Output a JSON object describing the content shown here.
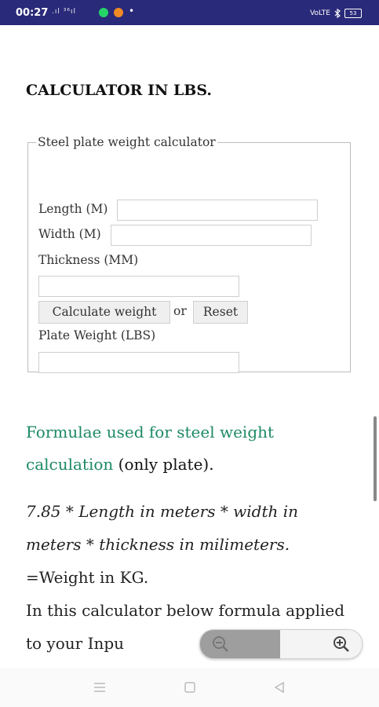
{
  "status_bar": {
    "time": "00:27",
    "signal_text": ".ıl ³⁶ıl",
    "more": "•",
    "network": "VoLTE",
    "battery": "53"
  },
  "page": {
    "heading": "CALCULATOR IN LBS.",
    "form": {
      "legend": "Steel plate weight calculator",
      "length_label": "Length (M)",
      "length_value": "",
      "width_label": "Width (M)",
      "width_value": "",
      "thickness_label": "Thickness (MM)",
      "thickness_value": "",
      "calculate_label": "Calculate weight",
      "or_text": "or",
      "reset_label": "Reset",
      "result_label": "Plate Weight (LBS)",
      "result_value": ""
    },
    "formula": {
      "title_link": "Formulae used for steel weight calculation",
      "title_suffix": " (only plate).",
      "expression": "7.85 * Length in meters * width in meters * thickness in milimeters.",
      "result_line": "=Weight in KG.",
      "note": "In this calculator below formula applied to your Inpu"
    }
  },
  "zoom_controls": {
    "zoom_out_icon": "zoom-out-icon",
    "zoom_in_icon": "zoom-in-icon"
  },
  "nav_bar": {
    "icons": [
      "menu-icon",
      "home-icon",
      "back-icon"
    ]
  }
}
